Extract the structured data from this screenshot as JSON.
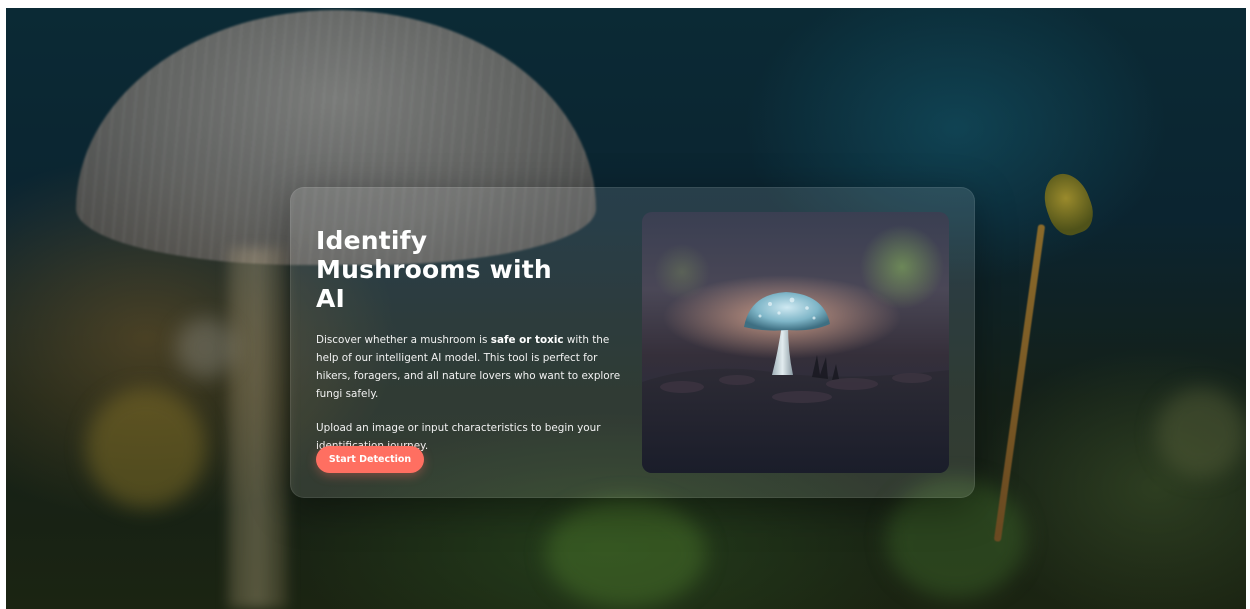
{
  "hero": {
    "title": "Identify Mushrooms with AI",
    "description": {
      "before": "Discover whether a mushroom is ",
      "emphasis": "safe or toxic",
      "after": " with the help of our intelligent AI model. This tool is perfect for hikers, foragers, and all nature lovers who want to explore fungi safely."
    },
    "secondary": "Upload an image or input characteristics to begin your identification journey.",
    "cta_label": "Start Detection"
  },
  "colors": {
    "accent": "#ff6f61",
    "text": "#ffffff"
  }
}
